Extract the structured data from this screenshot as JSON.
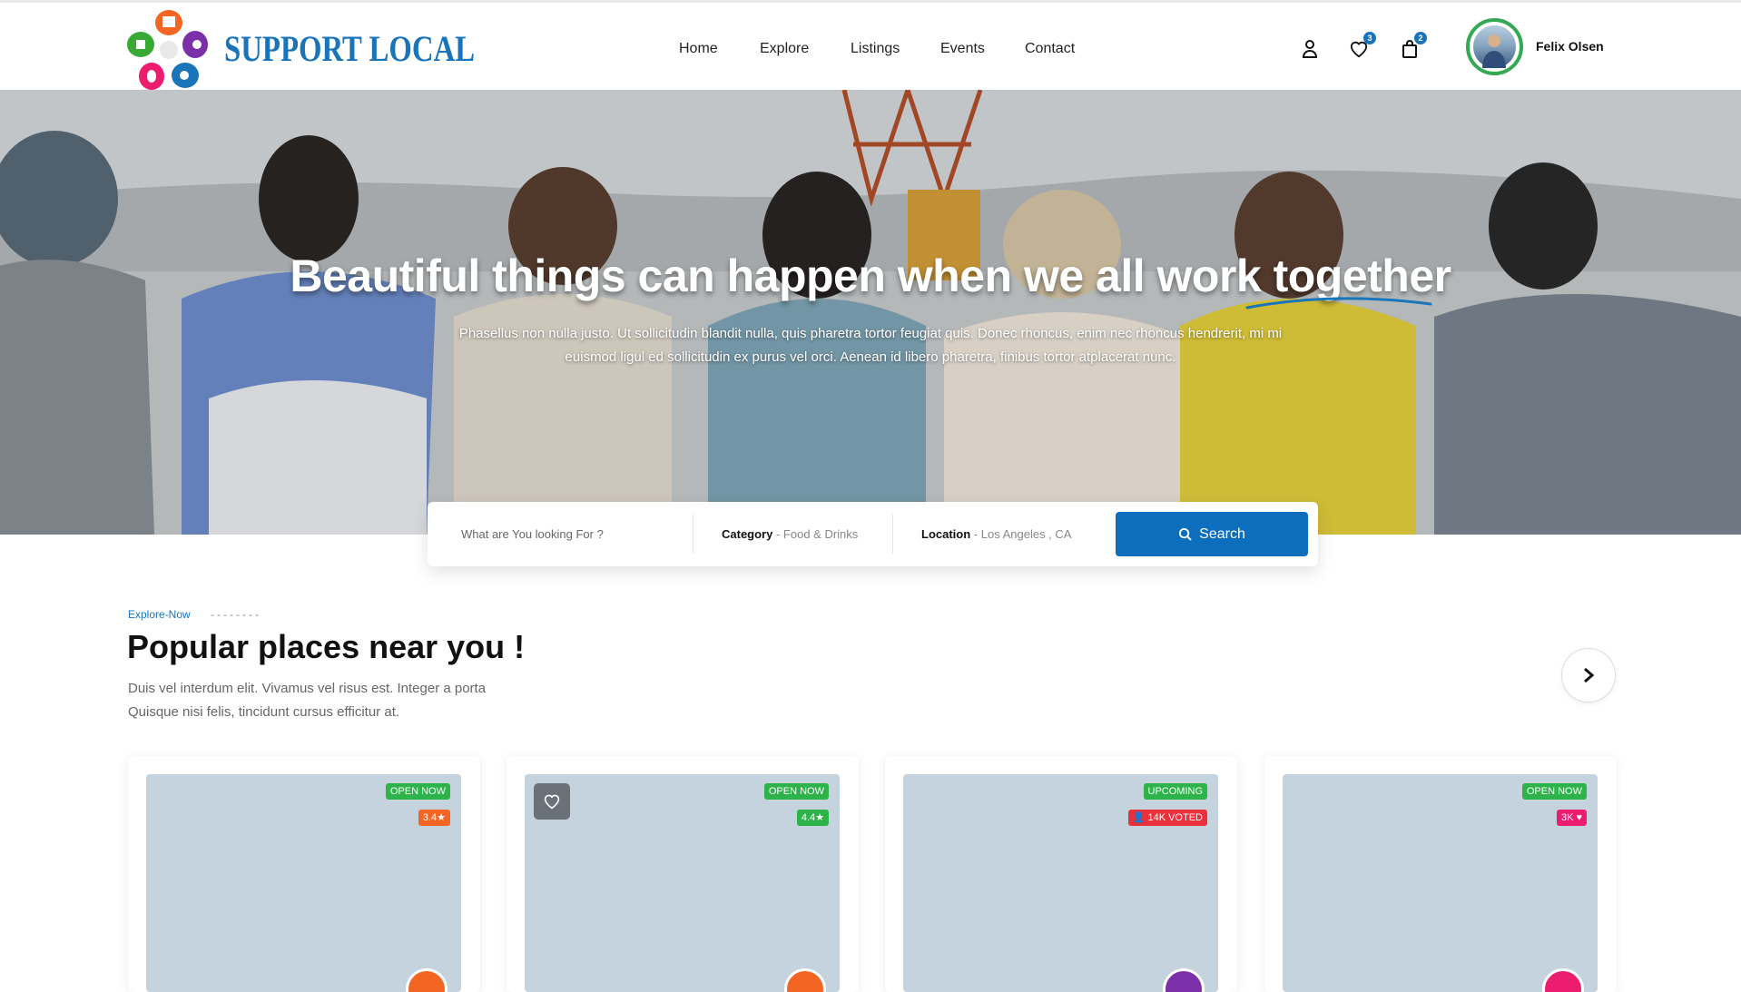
{
  "brand": {
    "name": "SUPPORT LOCAL"
  },
  "nav": {
    "items": [
      "Home",
      "Explore",
      "Listings",
      "Events",
      "Contact"
    ]
  },
  "header": {
    "wishlist_count": "3",
    "cart_count": "2",
    "user_name": "Felix Olsen"
  },
  "hero": {
    "title": "Beautiful things can happen when we all work together",
    "subtitle": "Phasellus non nulla justo. Ut sollicitudin blandit nulla, quis pharetra tortor feugiat quis. Donec rhoncus, enim nec rhoncus hendrerit, mi mi euismod ligul ed sollicitudin ex purus vel orci. Aenean id libero pharetra, finibus tortor atplacerat nunc."
  },
  "search": {
    "placeholder": "What are You looking For ?",
    "category_label": "Category",
    "category_value": "- Food & Drinks",
    "location_label": "Location",
    "location_value": "- Los Angeles , CA",
    "button_label": "Search"
  },
  "section": {
    "eyebrow": "Explore-Now",
    "eyebrow_dash": "--------",
    "title": "Popular places near you !",
    "description": "Duis vel interdum elit. Vivamus vel risus est. Integer a porta Quisque nisi felis, tincidunt cursus efficitur at."
  },
  "cards": [
    {
      "status": "OPEN NOW",
      "meta": "3.4★",
      "meta_color": "#f26522",
      "avatar_color": "#f26522",
      "has_fav": false
    },
    {
      "status": "OPEN NOW",
      "meta": "4.4★",
      "meta_color": "#2db34a",
      "avatar_color": "#f26522",
      "has_fav": true
    },
    {
      "status": "UPCOMING",
      "meta": "14K VOTED",
      "meta_color": "#e8313a",
      "avatar_color": "#7b2fa8",
      "has_fav": false
    },
    {
      "status": "OPEN NOW",
      "meta": "3K ♥",
      "meta_color": "#ec1c6f",
      "avatar_color": "#ec1c6f",
      "has_fav": false
    }
  ],
  "colors": {
    "primary": "#0d6ebd",
    "brand_text": "#1a74b9",
    "open_green": "#2db34a"
  }
}
